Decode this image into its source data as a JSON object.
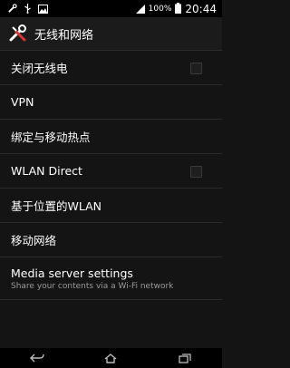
{
  "status_bar": {
    "battery_percent": "100%",
    "time": "20:44",
    "icons": [
      "tools-icon",
      "usb-icon",
      "image-icon",
      "signal-icon",
      "battery-icon"
    ]
  },
  "action_bar": {
    "title": "无线和网络",
    "icon": "tools-icon"
  },
  "settings": [
    {
      "label": "关闭无线电",
      "has_checkbox": true,
      "checked": false
    },
    {
      "label": "VPN",
      "has_checkbox": false
    },
    {
      "label": "绑定与移动热点",
      "has_checkbox": false
    },
    {
      "label": "WLAN Direct",
      "has_checkbox": true,
      "checked": false
    },
    {
      "label": "基于位置的WLAN",
      "has_checkbox": false
    },
    {
      "label": "移动网络",
      "has_checkbox": false
    },
    {
      "label": "Media server settings",
      "subtitle": "Share your contents via a Wi-Fi network",
      "has_checkbox": false
    }
  ],
  "nav_bar": {
    "buttons": [
      "back-icon",
      "home-icon",
      "recent-apps-icon"
    ]
  },
  "colors": {
    "background": "#141414",
    "bar": "#000000",
    "text": "#ffffff",
    "subtext": "#9a9a9a"
  }
}
